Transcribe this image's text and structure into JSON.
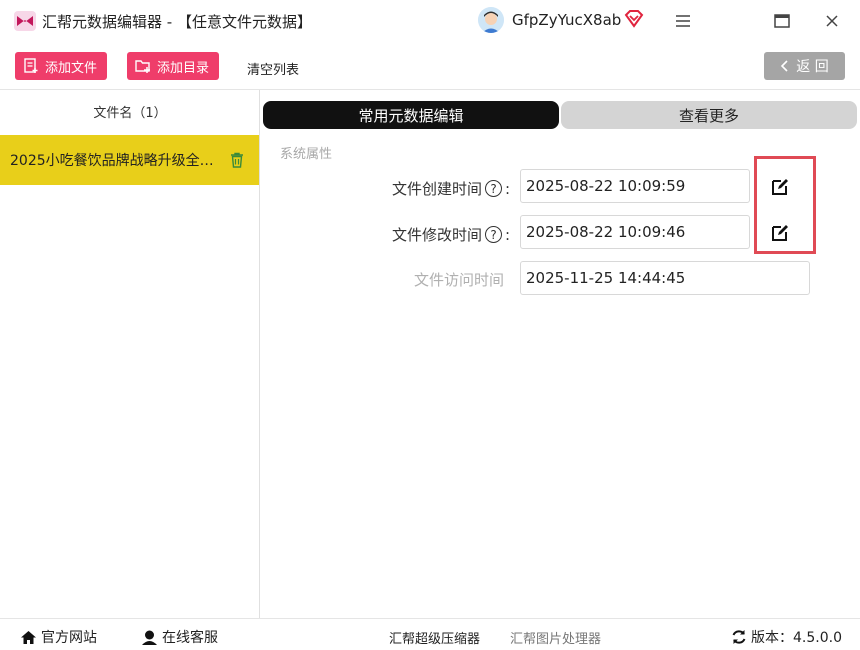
{
  "titlebar": {
    "app_title": "汇帮元数据编辑器 - 【任意文件元数据】",
    "username": "GfpZyYucX8ab",
    "logo_icon": "app-logo-icon",
    "vip_icon": "vip-diamond-icon"
  },
  "toolbar": {
    "add_file_label": "添加文件",
    "add_dir_label": "添加目录",
    "clear_list_label": "清空列表",
    "back_label": "返 回"
  },
  "file_list": {
    "header": "文件名（1）",
    "items": [
      {
        "name": "2025小吃餐饮品牌战略升级全案..."
      }
    ]
  },
  "tabs": [
    {
      "label": "常用元数据编辑",
      "active": true
    },
    {
      "label": "查看更多",
      "active": false
    }
  ],
  "section": {
    "label": "系统属性"
  },
  "fields": [
    {
      "label": "文件创建时间",
      "value": "2025-08-22 10:09:59",
      "editable": true
    },
    {
      "label": "文件修改时间",
      "value": "2025-08-22 10:09:46",
      "editable": true
    },
    {
      "label": "文件访问时间",
      "value": "2025-11-25 14:44:45",
      "editable": false
    }
  ],
  "footer": {
    "website": "官方网站",
    "support": "在线客服",
    "compressor": "汇帮超级压缩器",
    "image_tool": "汇帮图片处理器",
    "version": "版本：4.5.0.0"
  },
  "colors": {
    "accent_pink": "#ef3d6a",
    "selected_row": "#e8cf1a",
    "highlight_border": "#e04a55"
  }
}
